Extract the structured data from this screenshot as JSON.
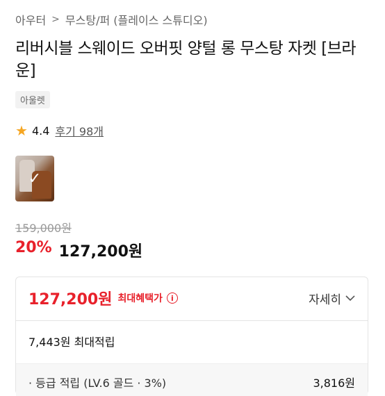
{
  "breadcrumb": {
    "level1": "아우터",
    "level2": "무스탕/퍼 (플레이스 스튜디오)",
    "separator": ">"
  },
  "product": {
    "title": "리버시블 스웨이드 오버핏 양털 롱 무스탕 자켓 [브라운]",
    "badge": "아울렛",
    "rating": "4.4",
    "reviews": "후기 98개",
    "original_price": "159,000원",
    "discount": "20%",
    "sale_price": "127,200원"
  },
  "benefit": {
    "max_price": "127,200원",
    "max_label": "최대혜택가",
    "details_label": "자세히",
    "points": "7,443원 최대적립",
    "grade_label": "· 등급 적립 (LV.6 골드 · 3%)",
    "grade_value": "3,816원"
  },
  "colors": {
    "accent_red": "#e8212b",
    "star": "#f5a623"
  }
}
